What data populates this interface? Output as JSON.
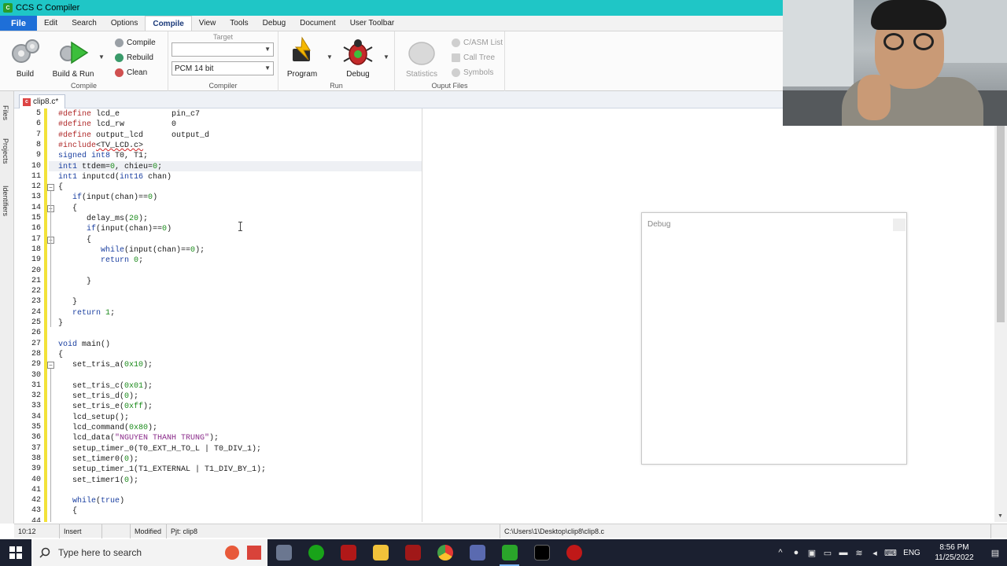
{
  "window": {
    "title": "CCS C Compiler"
  },
  "menu": [
    "File",
    "Edit",
    "Search",
    "Options",
    "Compile",
    "View",
    "Tools",
    "Debug",
    "Document",
    "User Toolbar"
  ],
  "ribbon": {
    "compile_group": {
      "label": "Compile",
      "build": "Build",
      "build_run": "Build & Run",
      "compile": "Compile",
      "rebuild": "Rebuild",
      "clean": "Clean"
    },
    "compiler_group": {
      "label": "Compiler",
      "target_caption": "Target",
      "target_value": "",
      "compiler_value": "PCM 14 bit"
    },
    "run_group": {
      "label": "Run",
      "program": "Program",
      "debug": "Debug"
    },
    "output_group": {
      "label": "Ouput Files",
      "statistics": "Statistics",
      "casm_list": "C/ASM List",
      "call_tree": "Call Tree",
      "symbols": "Symbols"
    }
  },
  "sidebar": {
    "files": "Files",
    "projects": "Projects",
    "identifiers": "Identifiers"
  },
  "tab": {
    "label": "clip8.c*"
  },
  "editor": {
    "line_numbers": [
      "5",
      "6",
      "7",
      "8",
      "9",
      "10",
      "11",
      "12",
      "13",
      "14",
      "15",
      "16",
      "17",
      "18",
      "19",
      "20",
      "21",
      "22",
      "23",
      "24",
      "25",
      "26",
      "27",
      "28",
      "29",
      "30",
      "31",
      "32",
      "33",
      "34",
      "35",
      "36",
      "37",
      "38",
      "39",
      "40",
      "41",
      "42",
      "43",
      "44"
    ],
    "lines": [
      "#define lcd_e           pin_c7",
      "#define lcd_rw          0",
      "#define output_lcd      output_d",
      "#include<TV_LCD.c>",
      "signed int8 T0, T1;",
      "int1 ttdem=0, chieu=0;",
      "int1 inputcd(int16 chan)",
      "{",
      "   if(input(chan)==0)",
      "   {",
      "      delay_ms(20);",
      "      if(input(chan)==0)",
      "      {",
      "         while(input(chan)==0);",
      "         return 0;",
      "",
      "      }",
      "",
      "   }",
      "   return 1;",
      "}",
      "",
      "void main()",
      "{",
      "   set_tris_a(0x10);",
      "",
      "   set_tris_c(0x01);",
      "   set_tris_d(0);",
      "   set_tris_e(0xff);",
      "   lcd_setup();",
      "   lcd_command(0x80);",
      "   lcd_data(\"NGUYEN THANH TRUNG\");",
      "   setup_timer_0(T0_EXT_H_TO_L | T0_DIV_1);",
      "   set_timer0(0);",
      "   setup_timer_1(T1_EXTERNAL | T1_DIV_BY_1);",
      "   set_timer1(0);",
      "",
      "   while(true)",
      "   {",
      ""
    ]
  },
  "debug_panel": {
    "title": "Debug"
  },
  "status": {
    "position": "10:12",
    "mode": "Insert",
    "modified": "Modified",
    "project": "Pjt: clip8",
    "path": "C:\\Users\\1\\Desktop\\clip8\\clip8.c"
  },
  "taskbar": {
    "search_placeholder": "Type here to search",
    "language": "ENG",
    "time": "8:56 PM",
    "date": "11/25/2022"
  }
}
